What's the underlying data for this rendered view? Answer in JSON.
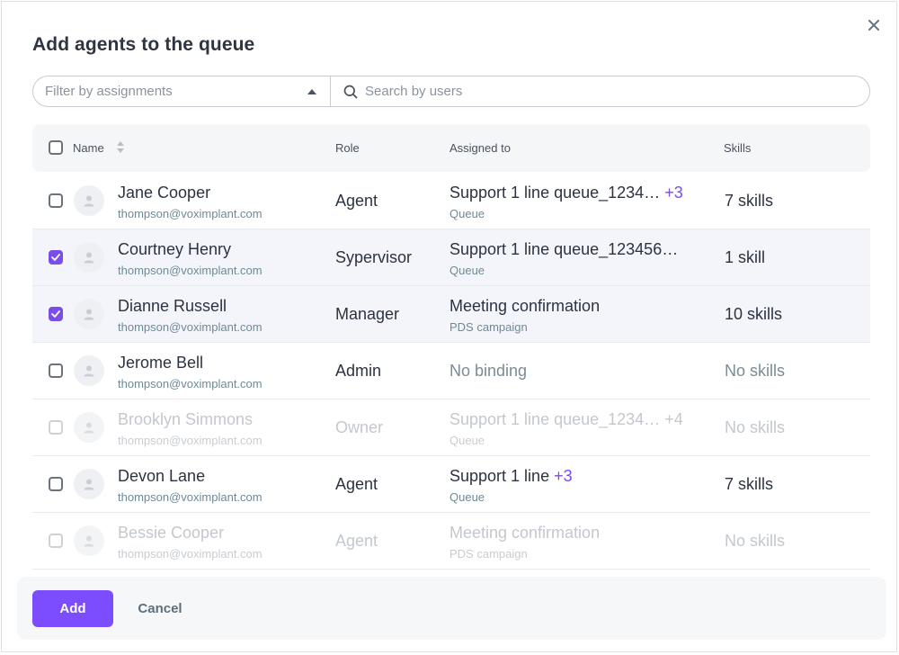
{
  "dialog": {
    "title": "Add agents to the queue",
    "close_icon": "close-icon"
  },
  "filters": {
    "assignment_placeholder": "Filter by assignments",
    "search_placeholder": "Search by users"
  },
  "columns": {
    "name": "Name",
    "role": "Role",
    "assigned_to": "Assigned to",
    "skills": "Skills"
  },
  "rows": [
    {
      "name": "Jane Cooper",
      "email": "thompson@voximplant.com",
      "role": "Agent",
      "assigned": "Support 1 line queue_1234…",
      "more": "+3",
      "assigned_type": "Queue",
      "skills": "7 skills",
      "checked": false,
      "disabled": false
    },
    {
      "name": "Courtney Henry",
      "email": "thompson@voximplant.com",
      "role": "Sypervisor",
      "assigned": "Support 1 line queue_123456…",
      "more": "",
      "assigned_type": "Queue",
      "skills": "1 skill",
      "checked": true,
      "disabled": false
    },
    {
      "name": "Dianne Russell",
      "email": "thompson@voximplant.com",
      "role": "Manager",
      "assigned": "Meeting confirmation",
      "more": "",
      "assigned_type": "PDS campaign",
      "skills": "10 skills",
      "checked": true,
      "disabled": false
    },
    {
      "name": "Jerome Bell",
      "email": "thompson@voximplant.com",
      "role": "Admin",
      "assigned": "No binding",
      "more": "",
      "assigned_type": "",
      "skills": "No skills",
      "checked": false,
      "disabled": false
    },
    {
      "name": "Brooklyn Simmons",
      "email": "thompson@voximplant.com",
      "role": "Owner",
      "assigned": "Support 1 line queue_1234…",
      "more": "+4",
      "assigned_type": "Queue",
      "skills": "No skills",
      "checked": false,
      "disabled": true
    },
    {
      "name": "Devon Lane",
      "email": "thompson@voximplant.com",
      "role": "Agent",
      "assigned": "Support 1 line",
      "more": "+3",
      "assigned_type": "Queue",
      "skills": "7 skills",
      "checked": false,
      "disabled": false
    },
    {
      "name": "Bessie Cooper",
      "email": "thompson@voximplant.com",
      "role": "Agent",
      "assigned": "Meeting confirmation",
      "more": "",
      "assigned_type": "PDS campaign",
      "skills": "No skills",
      "checked": false,
      "disabled": true
    }
  ],
  "footer": {
    "add_label": "Add",
    "cancel_label": "Cancel"
  },
  "colors": {
    "accent": "#7c4dff",
    "checkbox_checked": "#7a4ce9",
    "selected_row_bg": "#f4f5fb"
  }
}
